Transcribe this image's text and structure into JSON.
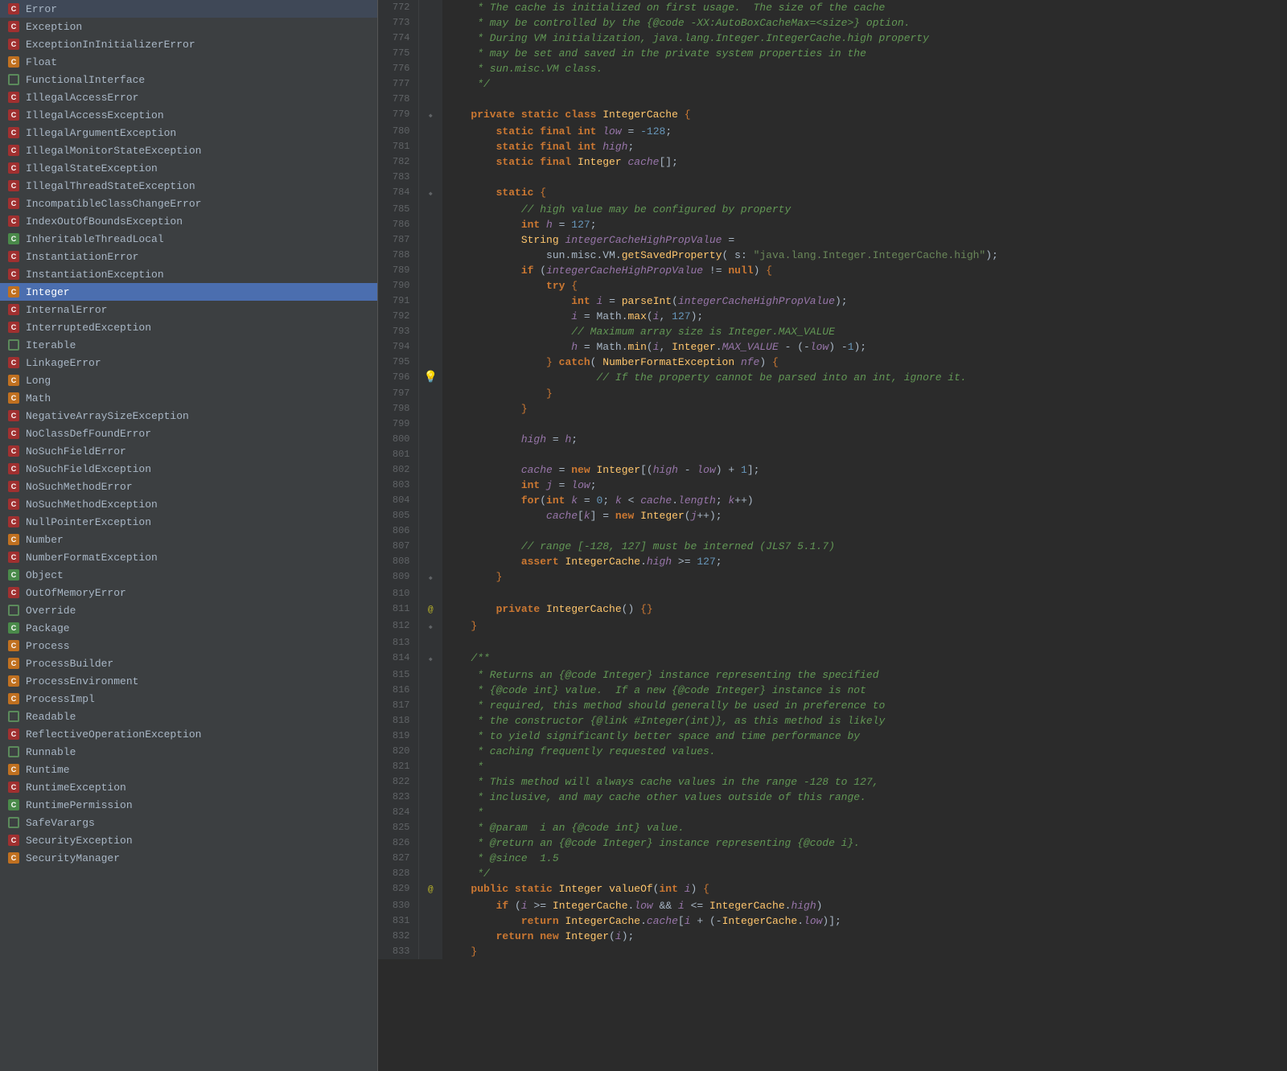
{
  "sidebar": {
    "items": [
      {
        "label": "Error",
        "type": "class",
        "color": "red",
        "selected": false
      },
      {
        "label": "Exception",
        "type": "class",
        "color": "red",
        "selected": false
      },
      {
        "label": "ExceptionInInitializerError",
        "type": "class",
        "color": "red",
        "selected": false
      },
      {
        "label": "Float",
        "type": "class",
        "color": "orange",
        "selected": false
      },
      {
        "label": "FunctionalInterface",
        "type": "interface",
        "color": "green",
        "selected": false
      },
      {
        "label": "IllegalAccessError",
        "type": "class",
        "color": "red",
        "selected": false
      },
      {
        "label": "IllegalAccessException",
        "type": "class",
        "color": "red",
        "selected": false
      },
      {
        "label": "IllegalArgumentException",
        "type": "class",
        "color": "red",
        "selected": false
      },
      {
        "label": "IllegalMonitorStateException",
        "type": "class",
        "color": "red",
        "selected": false
      },
      {
        "label": "IllegalStateException",
        "type": "class",
        "color": "red",
        "selected": false
      },
      {
        "label": "IllegalThreadStateException",
        "type": "class",
        "color": "red",
        "selected": false
      },
      {
        "label": "IncompatibleClassChangeError",
        "type": "class",
        "color": "red",
        "selected": false
      },
      {
        "label": "IndexOutOfBoundsException",
        "type": "class",
        "color": "red",
        "selected": false
      },
      {
        "label": "InheritableThreadLocal",
        "type": "class",
        "color": "green",
        "selected": false
      },
      {
        "label": "InstantiationError",
        "type": "class",
        "color": "red",
        "selected": false
      },
      {
        "label": "InstantiationException",
        "type": "class",
        "color": "red",
        "selected": false
      },
      {
        "label": "Integer",
        "type": "class",
        "color": "orange",
        "selected": true
      },
      {
        "label": "InternalError",
        "type": "class",
        "color": "red",
        "selected": false
      },
      {
        "label": "InterruptedException",
        "type": "class",
        "color": "red",
        "selected": false
      },
      {
        "label": "Iterable",
        "type": "interface",
        "color": "green",
        "selected": false
      },
      {
        "label": "LinkageError",
        "type": "class",
        "color": "red",
        "selected": false
      },
      {
        "label": "Long",
        "type": "class",
        "color": "orange",
        "selected": false
      },
      {
        "label": "Math",
        "type": "class",
        "color": "orange",
        "selected": false
      },
      {
        "label": "NegativeArraySizeException",
        "type": "class",
        "color": "red",
        "selected": false
      },
      {
        "label": "NoClassDefFoundError",
        "type": "class",
        "color": "red",
        "selected": false
      },
      {
        "label": "NoSuchFieldError",
        "type": "class",
        "color": "red",
        "selected": false
      },
      {
        "label": "NoSuchFieldException",
        "type": "class",
        "color": "red",
        "selected": false
      },
      {
        "label": "NoSuchMethodError",
        "type": "class",
        "color": "red",
        "selected": false
      },
      {
        "label": "NoSuchMethodException",
        "type": "class",
        "color": "red",
        "selected": false
      },
      {
        "label": "NullPointerException",
        "type": "class",
        "color": "red",
        "selected": false
      },
      {
        "label": "Number",
        "type": "class",
        "color": "orange",
        "selected": false
      },
      {
        "label": "NumberFormatException",
        "type": "class",
        "color": "red",
        "selected": false
      },
      {
        "label": "Object",
        "type": "class",
        "color": "green",
        "selected": false
      },
      {
        "label": "OutOfMemoryError",
        "type": "class",
        "color": "red",
        "selected": false
      },
      {
        "label": "Override",
        "type": "interface",
        "color": "green",
        "selected": false
      },
      {
        "label": "Package",
        "type": "class",
        "color": "green",
        "selected": false
      },
      {
        "label": "Process",
        "type": "class",
        "color": "orange",
        "selected": false
      },
      {
        "label": "ProcessBuilder",
        "type": "class",
        "color": "orange",
        "selected": false
      },
      {
        "label": "ProcessEnvironment",
        "type": "class",
        "color": "orange",
        "selected": false
      },
      {
        "label": "ProcessImpl",
        "type": "class",
        "color": "orange",
        "selected": false
      },
      {
        "label": "Readable",
        "type": "interface",
        "color": "green",
        "selected": false
      },
      {
        "label": "ReflectiveOperationException",
        "type": "class",
        "color": "red",
        "selected": false
      },
      {
        "label": "Runnable",
        "type": "interface",
        "color": "green",
        "selected": false
      },
      {
        "label": "Runtime",
        "type": "class",
        "color": "orange",
        "selected": false
      },
      {
        "label": "RuntimeException",
        "type": "class",
        "color": "red",
        "selected": false
      },
      {
        "label": "RuntimePermission",
        "type": "class",
        "color": "green",
        "selected": false
      },
      {
        "label": "SafeVarargs",
        "type": "interface",
        "color": "green",
        "selected": false
      },
      {
        "label": "SecurityException",
        "type": "class",
        "color": "red",
        "selected": false
      },
      {
        "label": "SecurityManager",
        "type": "class",
        "color": "orange",
        "selected": false
      }
    ]
  }
}
